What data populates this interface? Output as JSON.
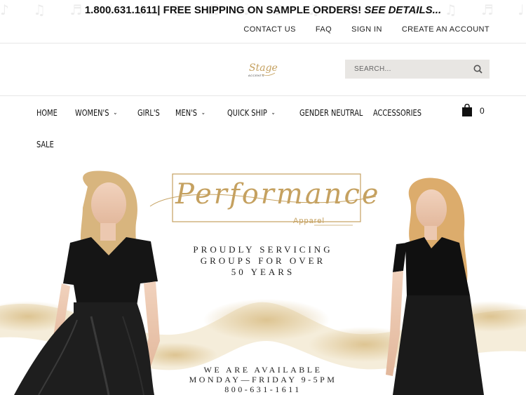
{
  "announcement": {
    "phone": "1.800.631.1611",
    "separator": "|",
    "shipping": "FREE SHIPPING ON SAMPLE ORDERS!",
    "details": "SEE DETAILS..."
  },
  "utility_links": [
    "CONTACT US",
    "FAQ",
    "SIGN IN",
    "CREATE AN ACCOUNT"
  ],
  "logo": {
    "text": "Stage",
    "subtext": "ACCENTS"
  },
  "search": {
    "placeholder": "SEARCH..."
  },
  "nav": {
    "items": [
      "HOME",
      "WOMEN'S",
      "GIRL'S",
      "MEN'S",
      "QUICK SHIP",
      "GENDER NEUTRAL",
      "ACCESSORIES",
      "SALE"
    ],
    "cart_count": "0"
  },
  "hero": {
    "title": "Performance",
    "subtitle": "Apparel",
    "tagline_1": [
      "PROUDLY SERVICING",
      "GROUPS FOR OVER",
      "50 YEARS"
    ],
    "tagline_2": [
      "WE ARE AVAILABLE",
      "MONDAY—FRIDAY 9-5PM",
      "800-631-1611"
    ]
  },
  "colors": {
    "gold": "#c5a160",
    "search_bg": "#e8e6e3",
    "text": "#111111"
  }
}
